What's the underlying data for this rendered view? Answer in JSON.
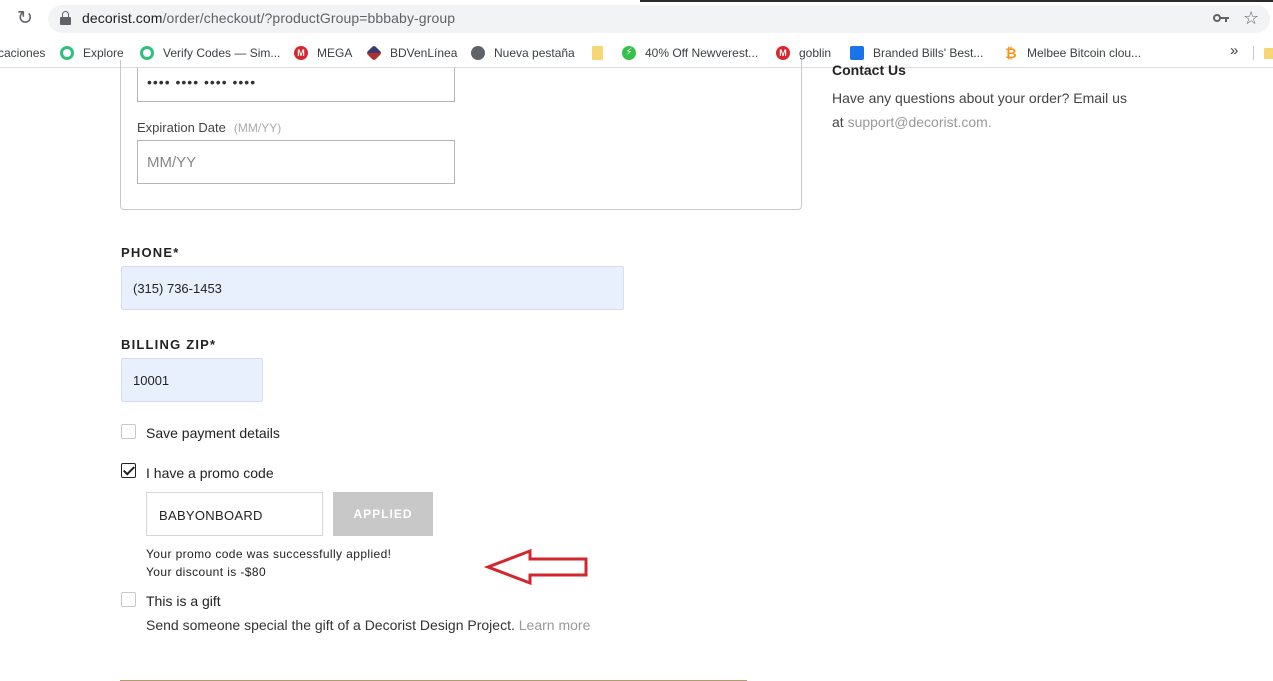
{
  "browser": {
    "url_host": "decorist.com",
    "url_path": "/order/checkout/?productGroup=bbbaby-group",
    "bookmarks": [
      {
        "label": "caciones",
        "icon": "none"
      },
      {
        "label": "Explore",
        "icon": "explore-icon"
      },
      {
        "label": "Verify Codes — Sim...",
        "icon": "verify-icon"
      },
      {
        "label": "MEGA",
        "icon": "mega-icon"
      },
      {
        "label": "BDVenLínea",
        "icon": "bdv-icon"
      },
      {
        "label": "Nueva pestaña",
        "icon": "globe-icon"
      },
      {
        "label": "",
        "icon": "folder-icon"
      },
      {
        "label": "40% Off Newverest...",
        "icon": "bolt-icon"
      },
      {
        "label": "goblin",
        "icon": "mega-icon"
      },
      {
        "label": "Branded Bills' Best...",
        "icon": "bill-icon"
      },
      {
        "label": "Melbee Bitcoin clou...",
        "icon": "bitcoin-icon"
      }
    ],
    "more_label": "»"
  },
  "card": {
    "card_number_value": "•••• •••• •••• ••••",
    "expiration_label": "Expiration Date",
    "expiration_hint": "(MM/YY)",
    "expiration_placeholder": "MM/YY"
  },
  "phone": {
    "label": "PHONE*",
    "value": "(315) 736-1453"
  },
  "billing_zip": {
    "label": "BILLING ZIP*",
    "value": "10001"
  },
  "save_payment": {
    "label": "Save payment details",
    "checked": false
  },
  "promo": {
    "label": "I have a promo code",
    "checked": true,
    "code_value": "BABYONBOARD",
    "button_label": "APPLIED",
    "success_message": "Your promo code was successfully applied!",
    "discount_message": "Your discount is -$80"
  },
  "gift": {
    "label": "This is a gift",
    "checked": false,
    "description": "Send someone special the gift of a Decorist Design Project.",
    "learn_more": "Learn more"
  },
  "contact": {
    "title": "Contact Us",
    "line1": "Have any questions about your order? Email us",
    "line2_prefix": "at",
    "email": "support@decorist.com."
  },
  "annotation": {
    "arrow_color": "#d0282e"
  }
}
